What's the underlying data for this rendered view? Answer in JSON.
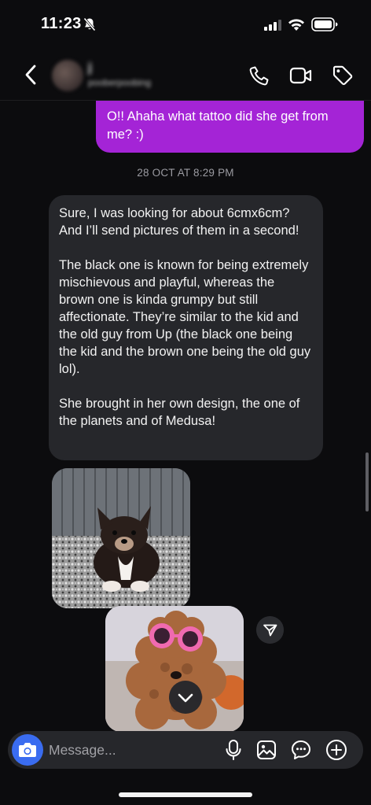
{
  "status_bar": {
    "time": "11:23",
    "icons": [
      "bell-off-icon",
      "signal-icon",
      "wifi-icon",
      "battery-icon"
    ]
  },
  "header": {
    "contact_name": "j",
    "contact_handle": "pooberpoobing",
    "icons": [
      "back-icon",
      "call-icon",
      "video-icon",
      "tag-icon"
    ]
  },
  "conversation": {
    "sent_message": "O!! Ahaha what tattoo did she get from me? :)",
    "timestamp": "28 OCT AT 8:29 PM",
    "received_paragraphs": [
      "Sure, I was looking for about 6cmx6cm? And I’ll send pictures of them in a second!",
      "The black one is known for being extremely mischievous and playful, whereas the brown one is kinda grumpy but still affectionate. They’re similar to the kid and the old guy from Up (the black one being the kid and the brown one being the old guy lol).",
      "She brought in her own design, the one of the planets and of Medusa!"
    ]
  },
  "composer": {
    "placeholder": "Message...",
    "icons": [
      "camera-icon",
      "mic-icon",
      "gallery-icon",
      "sticker-icon",
      "plus-icon"
    ]
  },
  "colors": {
    "background": "#0c0c0e",
    "sent_bubble": "#a424d6",
    "received_bubble": "#26272b",
    "camera_button": "#3a6cf0",
    "timestamp": "#9b9ba1"
  }
}
